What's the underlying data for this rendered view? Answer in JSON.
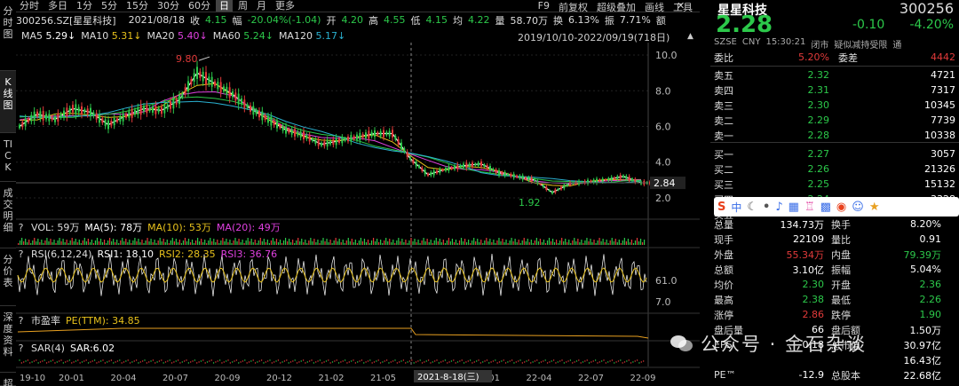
{
  "left_tabs": [
    "分时图",
    "K线图",
    "TICK",
    "成交明细",
    "分价表",
    "深度资料",
    "超"
  ],
  "periods": [
    "分时",
    "多日",
    "1分",
    "5分",
    "15分",
    "30分",
    "60分",
    "日",
    "周",
    "月",
    "更多"
  ],
  "active_period": "日",
  "top_menu": [
    "F9",
    "前复权",
    "超级叠加",
    "画线",
    "工具"
  ],
  "window_controls": [
    "close-icon",
    "collapse-icon"
  ],
  "info": {
    "code": "300256.SZ[星星科技]",
    "date": "2021/08/18",
    "close_label": "收",
    "close": "4.15",
    "chg_label": "幅",
    "chg": "-20.04%(-1.04)",
    "open_label": "开",
    "open": "4.20",
    "high_label": "高",
    "high": "4.55",
    "low_label": "低",
    "low": "4.15",
    "avg_label": "均",
    "avg": "4.22",
    "vol_label": "量",
    "vol": "58.70万",
    "turn_label": "换",
    "turn": "6.13%",
    "amp_label": "振",
    "amp": "7.71%",
    "amt_label": "额",
    "amt": ""
  },
  "ma": [
    {
      "label": "MA5",
      "value": "5.29↓",
      "color": "#ffffff"
    },
    {
      "label": "MA10",
      "value": "5.31↓",
      "color": "#e8c21c"
    },
    {
      "label": "MA20",
      "value": "5.40↓",
      "color": "#e040e0"
    },
    {
      "label": "MA60",
      "value": "5.24↓",
      "color": "#2cc84a"
    },
    {
      "label": "MA120",
      "value": "5.17↓",
      "color": "#2ab0d0"
    }
  ],
  "range": "2019/10/10-2022/09/19(718日)",
  "chart_data": {
    "type": "line",
    "title": "",
    "price_axis": [
      "10.0",
      "8.0",
      "6.0",
      "4.0",
      "2.0"
    ],
    "ylim": [
      1.5,
      10.5
    ],
    "last_price_tag": "2.84",
    "annotations": [
      {
        "text": "9.80",
        "date": "2020-08"
      },
      {
        "text": "1.92",
        "date": "2022-04"
      }
    ],
    "x_ticks": [
      "19-10",
      "20-01",
      "20-04",
      "20-07",
      "20-09",
      "20-12",
      "21-02",
      "21-05",
      "21",
      "22-01",
      "22-04",
      "22-07",
      "22-09"
    ],
    "crosshair_label": "2021-8-18(三)",
    "close_series": {
      "x": [
        "19-10",
        "19-11",
        "19-12",
        "20-01",
        "20-02",
        "20-03",
        "20-04",
        "20-05",
        "20-06",
        "20-07",
        "20-08",
        "20-09",
        "20-10",
        "20-11",
        "20-12",
        "21-01",
        "21-02",
        "21-03",
        "21-04",
        "21-05",
        "21-06",
        "21-07",
        "21-08",
        "21-09",
        "21-10",
        "21-11",
        "21-12",
        "22-01",
        "22-02",
        "22-03",
        "22-04",
        "22-05",
        "22-06",
        "22-07",
        "22-08",
        "22-09"
      ],
      "y": [
        6.0,
        6.7,
        6.4,
        7.0,
        6.8,
        6.1,
        6.6,
        7.0,
        6.9,
        7.5,
        9.0,
        8.4,
        7.8,
        7.0,
        6.4,
        5.8,
        5.5,
        5.0,
        5.2,
        5.4,
        5.6,
        5.6,
        4.2,
        3.3,
        3.6,
        3.8,
        3.9,
        3.4,
        3.2,
        3.0,
        2.3,
        2.8,
        2.9,
        3.0,
        3.2,
        2.84
      ]
    }
  },
  "indicators": [
    {
      "name": "VOL",
      "text": "VOL: 59万",
      "parts": [
        {
          "t": "MA(5): 78万",
          "c": "#ffffff"
        },
        {
          "t": "MA(10): 53万",
          "c": "#e8c21c"
        },
        {
          "t": "MA(20): 49万",
          "c": "#e040e0"
        }
      ]
    },
    {
      "name": "RSI",
      "text": "RSI(6,12,24)",
      "parts": [
        {
          "t": "RSI1: 18.10",
          "c": "#ffffff"
        },
        {
          "t": "RSI2: 28.35",
          "c": "#e8c21c"
        },
        {
          "t": "RSI3: 36.76",
          "c": "#e040e0"
        }
      ],
      "axis": [
        "61.0",
        "7.0"
      ]
    },
    {
      "name": "PE",
      "text": "市盈率",
      "parts": [
        {
          "t": "PE(TTM): 34.85",
          "c": "#e8c21c"
        }
      ]
    },
    {
      "name": "SAR",
      "text": "SAR(4)",
      "parts": [
        {
          "t": "SAR:6.02",
          "c": "#ffffff"
        }
      ]
    }
  ],
  "quote": {
    "name": "星星科技",
    "code": "300256",
    "price": "2.28",
    "change": "-0.10",
    "pct": "-4.20%",
    "meta": [
      "SZSE",
      "CNY",
      "15:30:21",
      "闭市",
      "疑似减持受限",
      "通"
    ]
  },
  "book": {
    "wei": [
      {
        "label": "委比",
        "value": "5.20%"
      },
      {
        "label": "委差",
        "value": "4442"
      }
    ],
    "asks": [
      {
        "label": "卖五",
        "price": "2.32",
        "vol": "4721"
      },
      {
        "label": "卖四",
        "price": "2.31",
        "vol": "7317"
      },
      {
        "label": "卖三",
        "price": "2.30",
        "vol": "10345"
      },
      {
        "label": "卖二",
        "price": "2.29",
        "vol": "7739"
      },
      {
        "label": "卖一",
        "price": "2.28",
        "vol": "10338"
      }
    ],
    "bids": [
      {
        "label": "买一",
        "price": "2.27",
        "vol": "3057"
      },
      {
        "label": "买二",
        "price": "2.26",
        "vol": "21326"
      },
      {
        "label": "买三",
        "price": "2.25",
        "vol": "15132"
      },
      {
        "label": "买四",
        "price": "2.24",
        "vol": "3328"
      },
      {
        "label": "买五",
        "price": "",
        "vol": ""
      }
    ]
  },
  "stats": [
    [
      {
        "l": "总量",
        "v": "134.73万",
        "c": "white"
      },
      {
        "l": "换手",
        "v": "8.20%",
        "c": "white"
      }
    ],
    [
      {
        "l": "现手",
        "v": "22109",
        "c": "white"
      },
      {
        "l": "量比",
        "v": "0.91",
        "c": "white"
      }
    ],
    [
      {
        "l": "外盘",
        "v": "55.34万",
        "c": "red"
      },
      {
        "l": "内盘",
        "v": "79.39万",
        "c": "green"
      }
    ],
    [
      {
        "l": "总额",
        "v": "3.10亿",
        "c": "white"
      },
      {
        "l": "振幅",
        "v": "5.04%",
        "c": "white"
      }
    ],
    [
      {
        "l": "均价",
        "v": "2.30",
        "c": "green"
      },
      {
        "l": "开盘",
        "v": "2.36",
        "c": "green"
      }
    ],
    [
      {
        "l": "最高",
        "v": "2.38",
        "c": "green"
      },
      {
        "l": "最低",
        "v": "2.26",
        "c": "green"
      }
    ],
    [
      {
        "l": "涨停",
        "v": "2.86",
        "c": "red"
      },
      {
        "l": "跌停",
        "v": "1.90",
        "c": "green"
      }
    ],
    [
      {
        "l": "盘后量",
        "v": "66",
        "c": "white"
      },
      {
        "l": "盘后额",
        "v": "1.50万",
        "c": "white"
      }
    ],
    [
      {
        "l": "EPS",
        "v": "-0.18",
        "c": "white"
      },
      {
        "l": "总市值",
        "v": "30.97亿",
        "c": "white"
      }
    ],
    [
      {
        "l": "",
        "v": "",
        "c": "white"
      },
      {
        "l": "",
        "v": "16.43亿",
        "c": "white"
      }
    ],
    [
      {
        "l": "PE™",
        "v": "-12.9",
        "c": "white"
      },
      {
        "l": "总股本",
        "v": "22.68亿",
        "c": "white"
      }
    ]
  ],
  "ime": {
    "label": "中",
    "icons": [
      "s-logo-icon",
      "moon-icon",
      "dot-icon",
      "mic-icon",
      "keyboard-icon",
      "shirt-icon",
      "grid-icon",
      "gamepad-icon",
      "user-icon",
      "star-icon"
    ]
  },
  "watermark": "公众号 · 金石杂谈"
}
